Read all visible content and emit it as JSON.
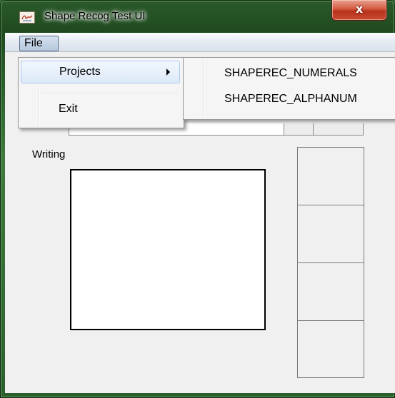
{
  "window": {
    "title": "Shape Recog Test UI",
    "close_glyph": "x",
    "app_icon": "app-icon",
    "frame_color": "#2f6a2f",
    "close_color": "#c8432a"
  },
  "menubar": {
    "file_label": "File"
  },
  "file_menu": {
    "items": [
      {
        "label": "Projects",
        "icon": "chevron-right-icon"
      },
      {
        "label": "Exit"
      }
    ]
  },
  "projects_submenu": {
    "items": [
      {
        "label": "SHAPEREC_NUMERALS"
      },
      {
        "label": "SHAPEREC_ALPHANUM"
      }
    ]
  },
  "main": {
    "writing_label": "Writing",
    "candidate_slots": 4
  },
  "colors": {
    "menu_highlight": "#dde9f8",
    "client_bg": "#f0f0f0"
  }
}
